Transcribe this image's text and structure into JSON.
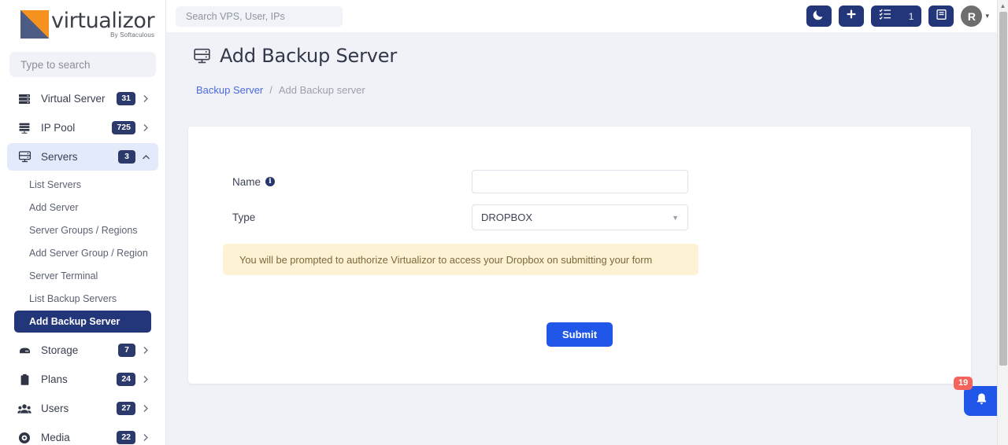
{
  "brand": {
    "name": "virtualizor",
    "tagline": "By Softaculous",
    "logo_orange": "#f5911e",
    "logo_blue": "#4c5c85"
  },
  "sidebar": {
    "search_placeholder": "Type to search",
    "items": [
      {
        "label": "Virtual Server",
        "badge": "31",
        "icon": "server-stack-icon",
        "caret": "chevron-right-icon",
        "active": false
      },
      {
        "label": "IP Pool",
        "badge": "725",
        "icon": "ip-pool-icon",
        "caret": "chevron-right-icon",
        "active": false
      },
      {
        "label": "Servers",
        "badge": "3",
        "icon": "server-monitor-icon",
        "caret": "chevron-up-icon",
        "active": true
      },
      {
        "label": "Storage",
        "badge": "7",
        "icon": "storage-icon",
        "caret": "chevron-right-icon",
        "active": false
      },
      {
        "label": "Plans",
        "badge": "24",
        "icon": "clipboard-icon",
        "caret": "chevron-right-icon",
        "active": false
      },
      {
        "label": "Users",
        "badge": "27",
        "icon": "users-icon",
        "caret": "chevron-right-icon",
        "active": false
      },
      {
        "label": "Media",
        "badge": "22",
        "icon": "disc-icon",
        "caret": "chevron-right-icon",
        "active": false
      }
    ],
    "submenu": [
      {
        "label": "List Servers",
        "active": false
      },
      {
        "label": "Add Server",
        "active": false
      },
      {
        "label": "Server Groups / Regions",
        "active": false
      },
      {
        "label": "Add Server Group / Region",
        "active": false
      },
      {
        "label": "Server Terminal",
        "active": false
      },
      {
        "label": "List Backup Servers",
        "active": false
      },
      {
        "label": "Add Backup Server",
        "active": true
      }
    ]
  },
  "topbar": {
    "search_placeholder": "Search VPS, User, IPs",
    "dark_mode_icon": "moon-icon",
    "add_icon": "plus-icon",
    "tasks_icon": "task-list-icon",
    "tasks_count": "1",
    "notes_icon": "document-icon",
    "avatar_initial": "R",
    "avatar_caret": "chevron-down-icon"
  },
  "page": {
    "icon": "server-monitor-icon",
    "title": "Add Backup Server"
  },
  "breadcrumb": {
    "parent": "Backup Server",
    "separator": "/",
    "current": "Add Backup server"
  },
  "form": {
    "name_label": "Name",
    "name_info_icon": "info-icon",
    "name_value": "",
    "name_placeholder": "",
    "type_label": "Type",
    "type_value": "DROPBOX",
    "type_caret": "caret-down-icon",
    "type_options": [
      "DROPBOX"
    ],
    "alert_text": "You will be prompted to authorize Virtualizor to access your Dropbox on submitting your form",
    "submit_label": "Submit",
    "submit_color": "#2157e8"
  },
  "fab": {
    "icon": "bell-icon",
    "badge": "19",
    "badge_color": "#f4645c"
  }
}
